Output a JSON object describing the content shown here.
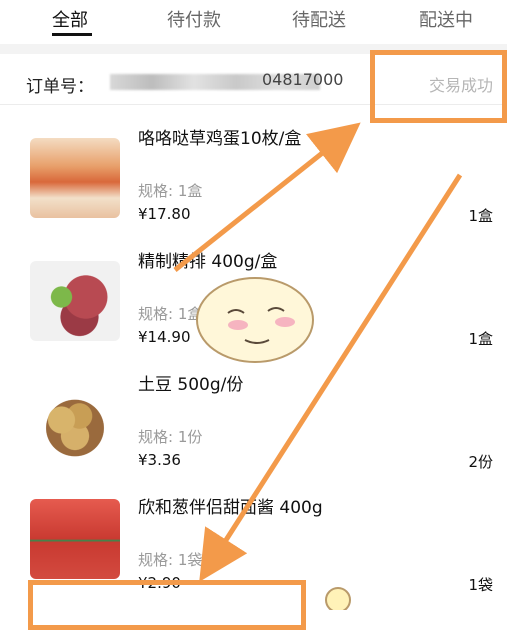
{
  "tabs": [
    "全部",
    "待付款",
    "待配送",
    "配送中"
  ],
  "order": {
    "label": "订单号：",
    "number_visible_tail": "04817000",
    "status": "交易成功"
  },
  "items": [
    {
      "name": "咯咯哒草鸡蛋10枚/盒",
      "spec": "规格: 1盒",
      "price": "¥17.80",
      "qty": "1盒"
    },
    {
      "name": "精制精排 400g/盒",
      "spec": "规格: 1盒",
      "price": "¥14.90",
      "qty": "1盒"
    },
    {
      "name": "土豆 500g/份",
      "spec": "规格: 1份",
      "price": "¥3.36",
      "qty": "2份"
    },
    {
      "name": "欣和葱伴侣甜面酱 400g",
      "spec": "规格: 1袋",
      "price": "¥2.90",
      "qty": "1袋"
    }
  ],
  "annotation": {
    "color": "#f39a4a"
  }
}
